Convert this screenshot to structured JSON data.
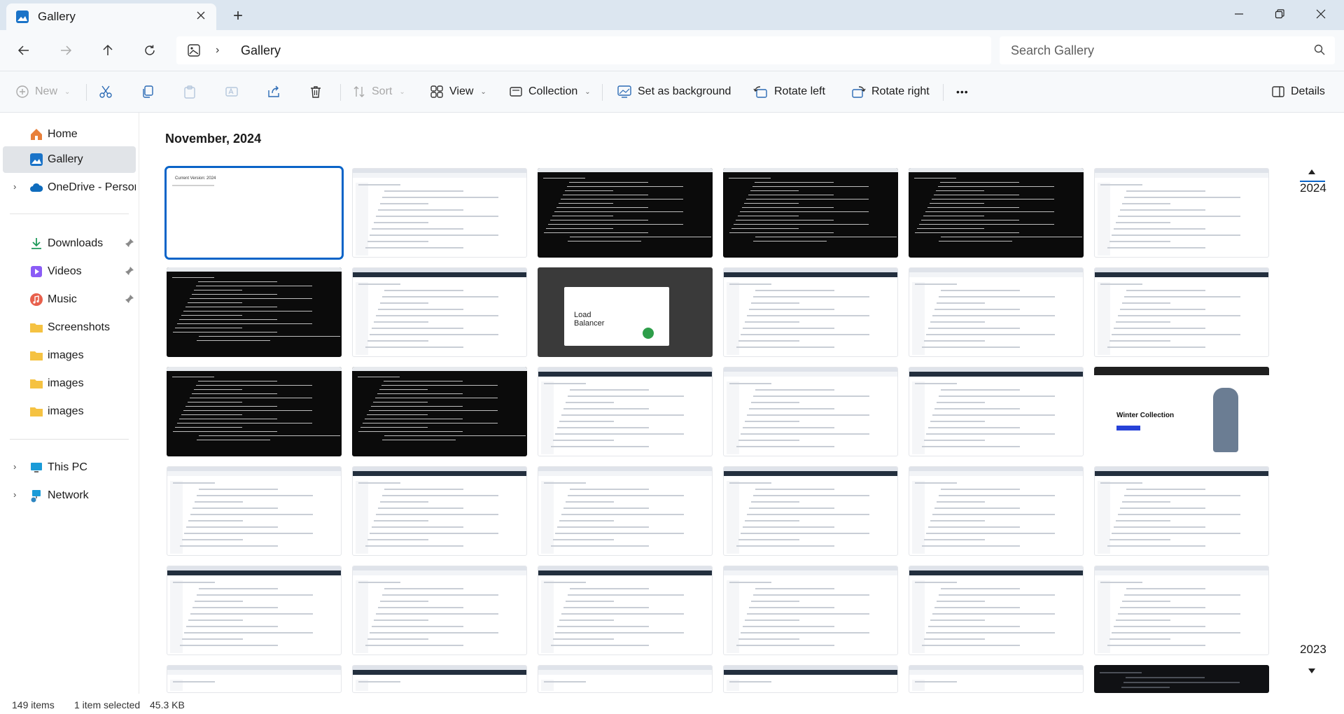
{
  "window": {
    "tab_title": "Gallery",
    "new_tab": "+",
    "icons": [
      "gallery-icon",
      "close-icon",
      "minimize-icon",
      "restore-icon"
    ]
  },
  "address": {
    "breadcrumb": "Gallery",
    "search_placeholder": "Search Gallery"
  },
  "commands": {
    "new": "New",
    "sort": "Sort",
    "view": "View",
    "collection": "Collection",
    "set_background": "Set as background",
    "rotate_left": "Rotate left",
    "rotate_right": "Rotate right",
    "more": "•••",
    "details": "Details"
  },
  "sidebar": {
    "items": [
      {
        "label": "Home",
        "icon": "home-icon"
      },
      {
        "label": "Gallery",
        "icon": "gallery-icon",
        "selected": true
      },
      {
        "label": "OneDrive - Persona",
        "icon": "cloud-icon"
      },
      {
        "label": "Downloads",
        "icon": "download-icon"
      },
      {
        "label": "Videos",
        "icon": "video-icon"
      },
      {
        "label": "Music",
        "icon": "music-icon"
      },
      {
        "label": "Screenshots",
        "icon": "folder-icon"
      },
      {
        "label": "images",
        "icon": "folder-icon"
      },
      {
        "label": "images",
        "icon": "folder-icon"
      },
      {
        "label": "images",
        "icon": "folder-icon"
      },
      {
        "label": "This PC",
        "icon": "pc-icon"
      },
      {
        "label": "Network",
        "icon": "network-icon"
      }
    ]
  },
  "content": {
    "month_heading": "November, 2024",
    "thumb_texts": {
      "lb_title": "Load\nBalancer",
      "lb_right": "Load\nBalancer",
      "winter": "Winter Collection",
      "current_version": "Current Version: 2024"
    }
  },
  "timeline": {
    "year_top": "2024",
    "year_bottom": "2023"
  },
  "status": {
    "items_count": "149 items",
    "selection": "1 item selected",
    "size": "45.3 KB"
  },
  "colors": {
    "accent": "#0a64c8",
    "titlebar": "#dce6f0",
    "toolbar": "#f7f9fb"
  }
}
